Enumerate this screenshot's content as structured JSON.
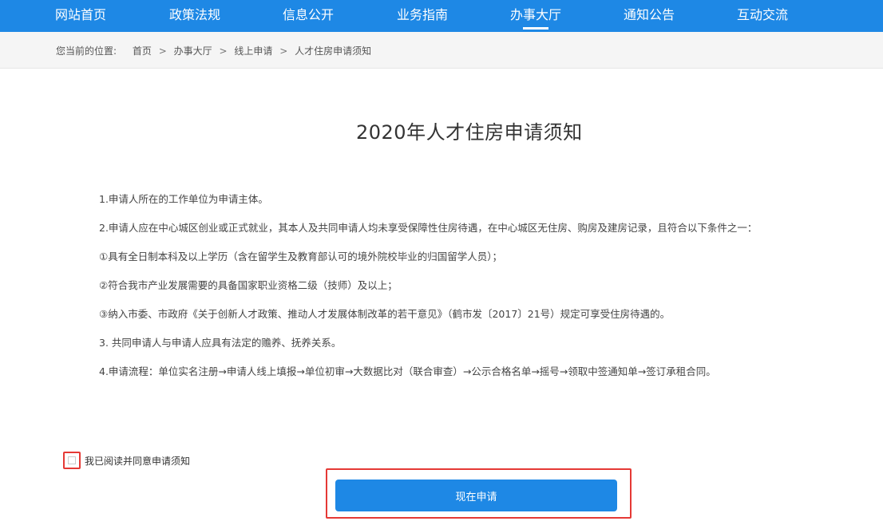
{
  "nav": {
    "items": [
      {
        "label": "网站首页"
      },
      {
        "label": "政策法规"
      },
      {
        "label": "信息公开"
      },
      {
        "label": "业务指南"
      },
      {
        "label": "办事大厅"
      },
      {
        "label": "通知公告"
      },
      {
        "label": "互动交流"
      }
    ],
    "active_index": 4
  },
  "breadcrumb": {
    "prefix": "您当前的位置:",
    "items": [
      "首页",
      "办事大厅",
      "线上申请",
      "人才住房申请须知"
    ],
    "separator": ">"
  },
  "notice": {
    "title": "2020年人才住房申请须知",
    "lines": [
      "1.申请人所在的工作单位为申请主体。",
      "2.申请人应在中心城区创业或正式就业，其本人及共同申请人均未享受保障性住房待遇，在中心城区无住房、购房及建房记录，且符合以下条件之一：",
      "①具有全日制本科及以上学历（含在留学生及教育部认可的境外院校毕业的归国留学人员）；",
      "②符合我市产业发展需要的具备国家职业资格二级（技师）及以上；",
      "③纳入市委、市政府《关于创新人才政策、推动人才发展体制改革的若干意见》（鹤市发〔2017〕21号）规定可享受住房待遇的。",
      "3. 共同申请人与申请人应具有法定的赡养、抚养关系。",
      "4.申请流程：单位实名注册→申请人线上填报→单位初审→大数据比对（联合审查）→公示合格名单→摇号→领取中签通知单→签订承租合同。"
    ]
  },
  "agreement": {
    "label": "我已阅读并同意申请须知"
  },
  "apply": {
    "label": "现在申请"
  },
  "colors": {
    "primary": "#1e88e5",
    "highlight": "#e53935"
  }
}
